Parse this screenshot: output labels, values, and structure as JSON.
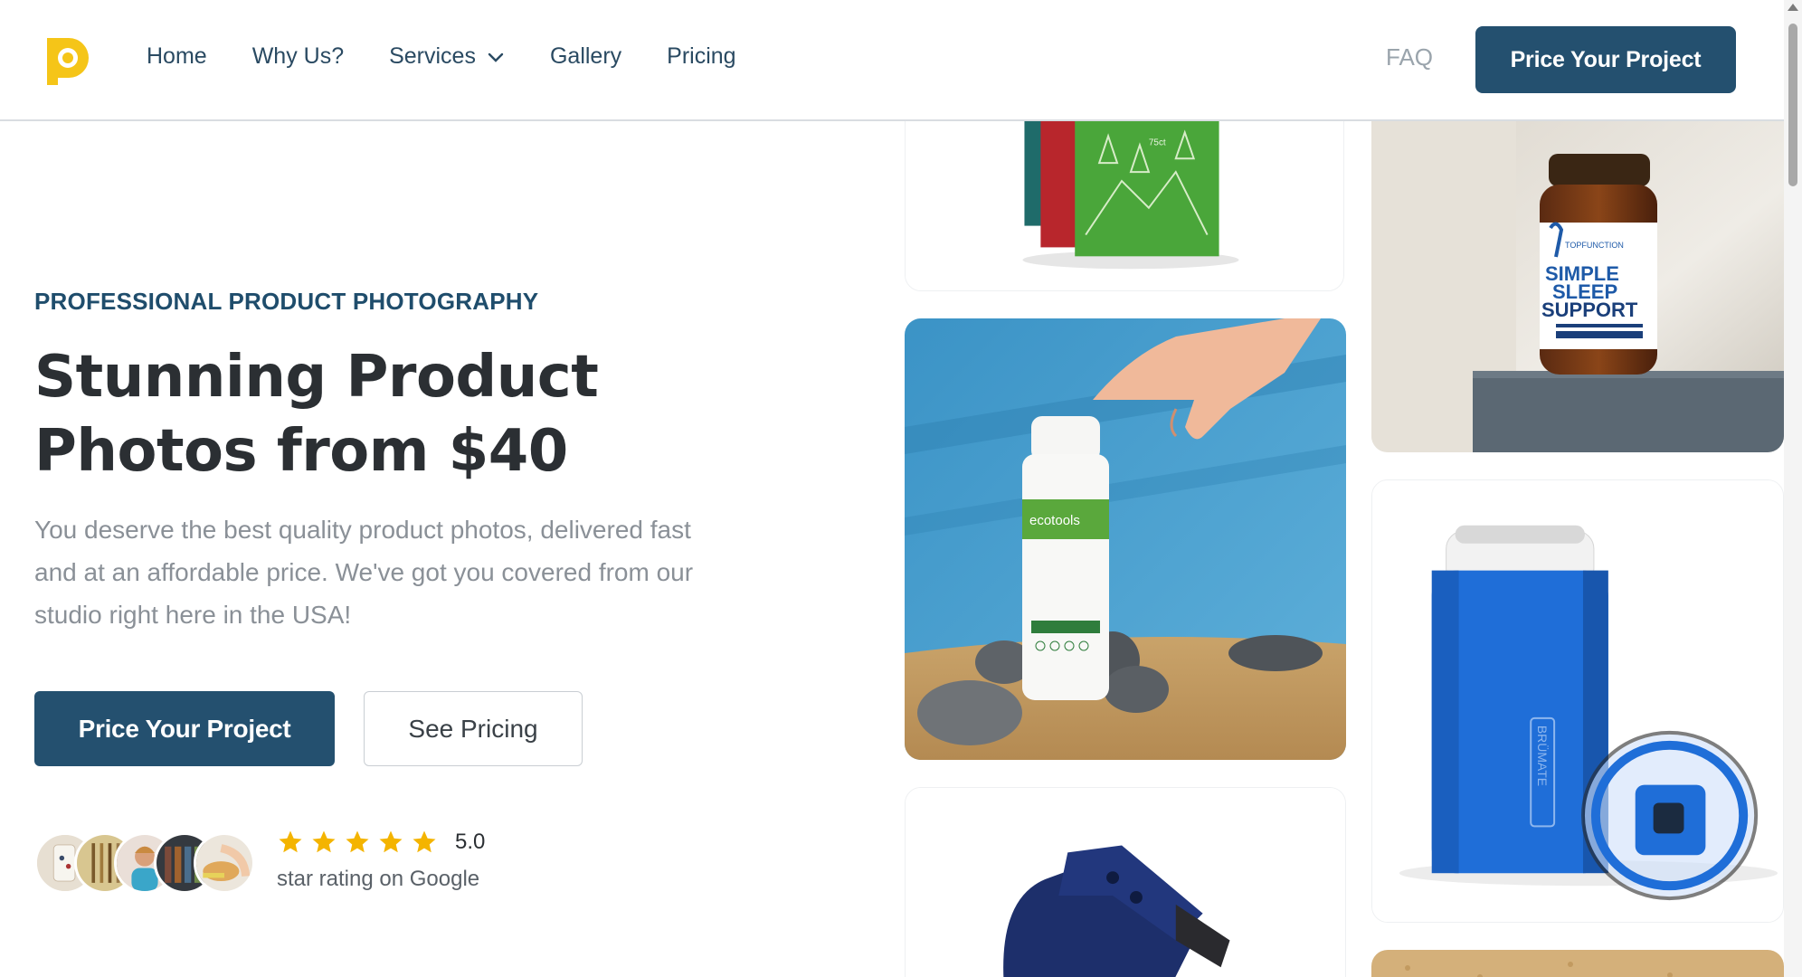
{
  "nav": {
    "items": [
      {
        "label": "Home"
      },
      {
        "label": "Why Us?"
      },
      {
        "label": "Services",
        "has_dropdown": true
      },
      {
        "label": "Gallery"
      },
      {
        "label": "Pricing"
      }
    ],
    "faq_label": "FAQ",
    "cta_label": "Price Your Project",
    "logo_icon": "brand-logo-icon"
  },
  "hero": {
    "eyebrow": "PROFESSIONAL PRODUCT PHOTOGRAPHY",
    "headline_line1": "Stunning Product",
    "headline_line2": "Photos from $40",
    "lead": "You deserve the best quality product photos, delivered fast and at an affordable price. We've got you covered from our studio right here in the USA!",
    "primary_cta": "Price Your Project",
    "secondary_cta": "See Pricing",
    "rating_score": "5.0",
    "rating_caption": "star rating on Google",
    "rating_stars": 5
  },
  "gallery": {
    "tea_box_label": "75ct",
    "bottle_brand": "TOPFUNCTION",
    "bottle_title_1": "SIMPLE",
    "bottle_title_2": "SLEEP",
    "bottle_title_3": "SUPPORT",
    "cleanser_brand": "ecotools",
    "cooler_brand": "BRÜMATE"
  },
  "colors": {
    "brand_navy": "#24506f",
    "logo_yellow": "#f5c518",
    "star_gold": "#f4b400"
  }
}
